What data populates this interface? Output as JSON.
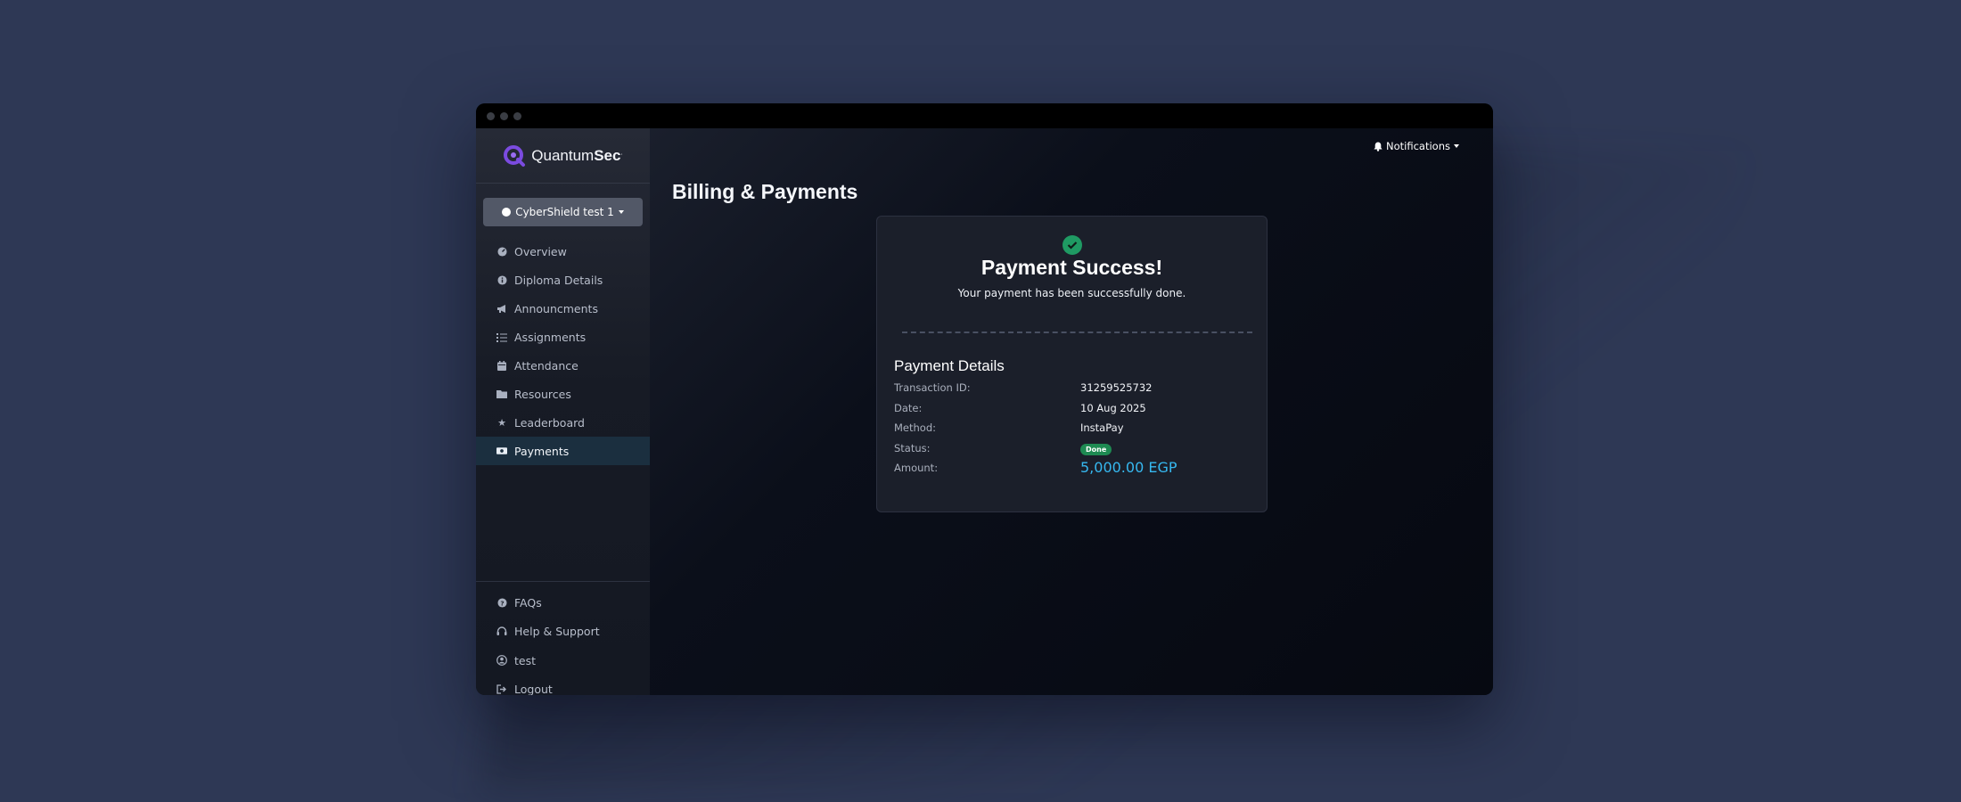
{
  "brand": {
    "name_light": "Quantum",
    "name_bold": "Sec",
    "mark": "."
  },
  "org": {
    "label": "CyberShield test 1"
  },
  "sidebar": {
    "items": [
      {
        "label": "Overview",
        "icon": "gauge-icon"
      },
      {
        "label": "Diploma Details",
        "icon": "info-icon"
      },
      {
        "label": "Announcments",
        "icon": "megaphone-icon"
      },
      {
        "label": "Assignments",
        "icon": "list-icon"
      },
      {
        "label": "Attendance",
        "icon": "calendar-icon"
      },
      {
        "label": "Resources",
        "icon": "folder-icon"
      },
      {
        "label": "Leaderboard",
        "icon": "star-icon"
      },
      {
        "label": "Payments",
        "icon": "money-icon",
        "active": true
      }
    ],
    "bottom_items": [
      {
        "label": "FAQs",
        "icon": "question-icon"
      },
      {
        "label": "Help & Support",
        "icon": "headset-icon"
      },
      {
        "label": "test",
        "icon": "user-icon"
      },
      {
        "label": "Logout",
        "icon": "logout-icon"
      }
    ]
  },
  "header": {
    "notifications_label": "Notifications"
  },
  "page": {
    "title": "Billing & Payments"
  },
  "payment": {
    "success_title": "Payment Success!",
    "success_subtitle": "Your payment has been successfully done.",
    "details_title": "Payment Details",
    "rows": [
      {
        "key": "Transaction ID:",
        "value": "31259525732"
      },
      {
        "key": "Date:",
        "value": "10 Aug 2025"
      },
      {
        "key": "Method:",
        "value": "InstaPay"
      },
      {
        "key": "Status:",
        "value": "Done"
      },
      {
        "key": "Amount:",
        "value": "5,000.00 EGP"
      }
    ]
  },
  "colors": {
    "accent": "#36b8f0",
    "success": "#1f9a63",
    "active_bg": "#1b2f3f",
    "brand": "#7b4be0"
  }
}
